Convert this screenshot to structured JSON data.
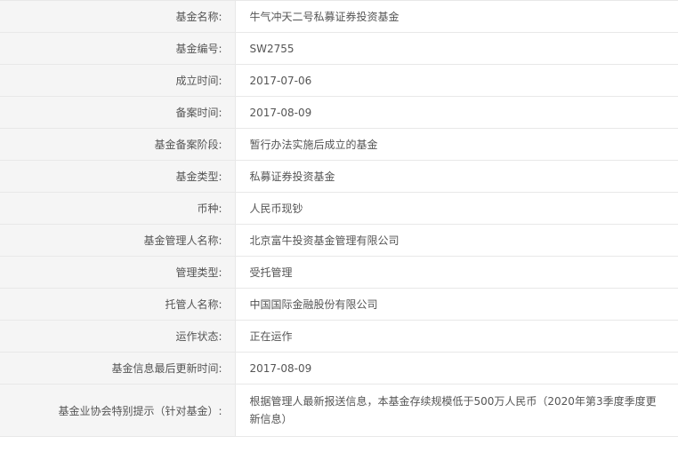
{
  "rows": [
    {
      "label": "基金名称:",
      "value": "牛气冲天二号私募证券投资基金"
    },
    {
      "label": "基金编号:",
      "value": "SW2755"
    },
    {
      "label": "成立时间:",
      "value": "2017-07-06"
    },
    {
      "label": "备案时间:",
      "value": "2017-08-09"
    },
    {
      "label": "基金备案阶段:",
      "value": "暂行办法实施后成立的基金"
    },
    {
      "label": "基金类型:",
      "value": "私募证券投资基金"
    },
    {
      "label": "币种:",
      "value": "人民币现钞"
    },
    {
      "label": "基金管理人名称:",
      "value": "北京富牛投资基金管理有限公司"
    },
    {
      "label": "管理类型:",
      "value": "受托管理"
    },
    {
      "label": "托管人名称:",
      "value": "中国国际金融股份有限公司"
    },
    {
      "label": "运作状态:",
      "value": "正在运作"
    },
    {
      "label": "基金信息最后更新时间:",
      "value": "2017-08-09"
    },
    {
      "label": "基金业协会特别提示（针对基金）:",
      "value": "根据管理人最新报送信息，本基金存续规模低于500万人民币（2020年第3季度季度更新信息）"
    }
  ]
}
